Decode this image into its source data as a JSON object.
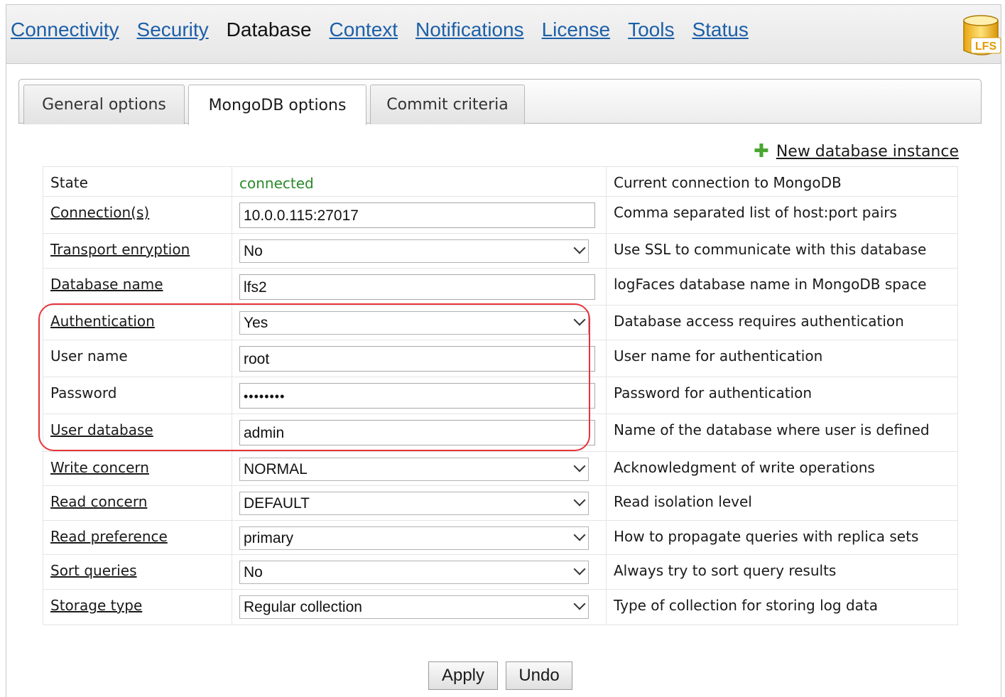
{
  "topnav": {
    "items": [
      {
        "label": "Connectivity",
        "current": false
      },
      {
        "label": "Security",
        "current": false
      },
      {
        "label": "Database",
        "current": true
      },
      {
        "label": "Context",
        "current": false
      },
      {
        "label": "Notifications",
        "current": false
      },
      {
        "label": "License",
        "current": false
      },
      {
        "label": "Tools",
        "current": false
      },
      {
        "label": "Status",
        "current": false
      }
    ],
    "logo_text": "LFS"
  },
  "tabs": [
    {
      "label": "General options",
      "active": false
    },
    {
      "label": "MongoDB options",
      "active": true
    },
    {
      "label": "Commit criteria",
      "active": false
    }
  ],
  "new_instance_label": "New database instance",
  "rows": [
    {
      "label": "State",
      "link": false,
      "kind": "text",
      "value": "connected",
      "desc": "Current connection to MongoDB"
    },
    {
      "label": "Connection(s)",
      "link": true,
      "kind": "input",
      "value": "10.0.0.115:27017",
      "desc": "Comma separated list of host:port pairs"
    },
    {
      "label": "Transport enryption",
      "link": true,
      "kind": "select",
      "value": "No",
      "desc": "Use SSL to communicate with this database"
    },
    {
      "label": "Database name",
      "link": true,
      "kind": "input",
      "value": "lfs2",
      "desc": "logFaces database name in MongoDB space"
    },
    {
      "label": "Authentication",
      "link": true,
      "kind": "select",
      "value": "Yes",
      "desc": "Database access requires authentication"
    },
    {
      "label": "User name",
      "link": false,
      "kind": "input",
      "value": "root",
      "desc": "User name for authentication"
    },
    {
      "label": "Password",
      "link": false,
      "kind": "password",
      "value": "••••••••",
      "desc": "Password for authentication"
    },
    {
      "label": "User database",
      "link": true,
      "kind": "input",
      "value": "admin",
      "desc": "Name of the database where user is defined"
    },
    {
      "label": "Write concern",
      "link": true,
      "kind": "select",
      "value": "NORMAL",
      "desc": "Acknowledgment of write operations"
    },
    {
      "label": "Read concern",
      "link": true,
      "kind": "select",
      "value": "DEFAULT",
      "desc": "Read isolation level"
    },
    {
      "label": "Read preference",
      "link": true,
      "kind": "select",
      "value": "primary",
      "desc": "How to propagate queries with replica sets"
    },
    {
      "label": "Sort queries",
      "link": true,
      "kind": "select",
      "value": "No",
      "desc": "Always try to sort query results"
    },
    {
      "label": "Storage type",
      "link": true,
      "kind": "select",
      "value": "Regular collection",
      "desc": "Type of collection for storing log data"
    }
  ],
  "buttons": {
    "apply": "Apply",
    "undo": "Undo"
  },
  "colors": {
    "link": "#1c5fa8",
    "connected": "#2a8a2a",
    "highlight": "#e8333a",
    "add": "#4aa631"
  }
}
